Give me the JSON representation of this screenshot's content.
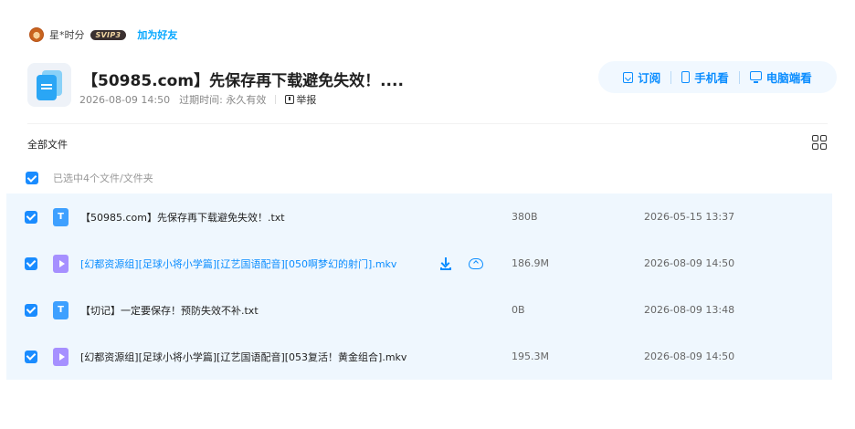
{
  "owner": {
    "name": "星*时分",
    "vip_badge": "SVIP3",
    "add_friend": "加为好友"
  },
  "share": {
    "title": "【50985.com】先保存再下载避免失效！....",
    "date": "2026-08-09 14:50",
    "expiry_label": "过期时间: 永久有效",
    "report": "举报"
  },
  "actions": {
    "subscribe": "订阅",
    "mobile": "手机看",
    "desktop": "电脑端看"
  },
  "toolbar": {
    "all_files": "全部文件",
    "selected_text": "已选中4个文件/文件夹"
  },
  "files": [
    {
      "icon": "txt-file-icon",
      "icon_glyph": "T",
      "name": "【50985.com】先保存再下载避免失效！.txt",
      "size": "380B",
      "date": "2026-05-15 13:37",
      "checked": true
    },
    {
      "icon": "video-file-icon",
      "icon_glyph": "",
      "name": "[幻都资源组][足球小将小学篇][辽艺国语配音][050啊梦幻的射门].mkv",
      "size": "186.9M",
      "date": "2026-08-09 14:50",
      "checked": true,
      "hovered": true
    },
    {
      "icon": "txt-file-icon",
      "icon_glyph": "T",
      "name": "【切记】一定要保存！预防失效不补.txt",
      "size": "0B",
      "date": "2026-08-09 13:48",
      "checked": true
    },
    {
      "icon": "video-file-icon",
      "icon_glyph": "",
      "name": "[幻都资源组][足球小将小学篇][辽艺国语配音][053复活！黄金组合].mkv",
      "size": "195.3M",
      "date": "2026-08-09 14:50",
      "checked": true
    }
  ],
  "colors": {
    "accent": "#0b8dff",
    "selected_row_bg": "#eff7fe",
    "video_icon": "#a690ff",
    "txt_icon": "#3ea0ff"
  }
}
